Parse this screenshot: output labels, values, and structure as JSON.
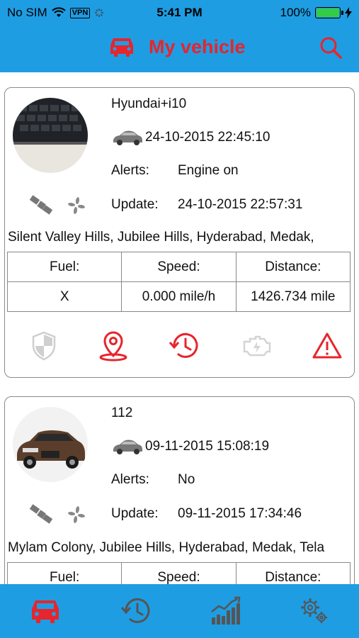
{
  "status_bar": {
    "carrier": "No SIM",
    "vpn": "VPN",
    "time": "5:41 PM",
    "battery": "100%"
  },
  "header": {
    "title": "My vehicle",
    "title_icon": "car-icon",
    "search_icon": "search-icon"
  },
  "vehicles": [
    {
      "name": "Hyundai+i10",
      "time": "24-10-2015 22:45:10",
      "alerts_label": "Alerts:",
      "alerts": "Engine on",
      "update_label": "Update:",
      "update": "24-10-2015 22:57:31",
      "address": "Silent Valley Hills, Jubilee Hills, Hyderabad, Medak,",
      "stats_headers": [
        "Fuel:",
        "Speed:",
        "Distance:"
      ],
      "stats_values": [
        "X",
        "0.000 mile/h",
        "1426.734 mile"
      ],
      "actions": [
        "shield-icon",
        "location-pin-icon",
        "history-icon",
        "engine-icon",
        "warning-icon"
      ]
    },
    {
      "name": "112",
      "time": "09-11-2015 15:08:19",
      "alerts_label": "Alerts:",
      "alerts": "No",
      "update_label": "Update:",
      "update": "09-11-2015 17:34:46",
      "address": "Mylam Colony, Jubilee Hills, Hyderabad, Medak, Tela",
      "stats_headers": [
        "Fuel:",
        "Speed:",
        "Distance:"
      ]
    }
  ],
  "tabbar": {
    "tabs": [
      "car-icon",
      "history-icon",
      "chart-icon",
      "settings-icon"
    ],
    "active": "car-icon"
  },
  "colors": {
    "brand_blue": "#1e9de3",
    "accent_red": "#e8242c"
  }
}
